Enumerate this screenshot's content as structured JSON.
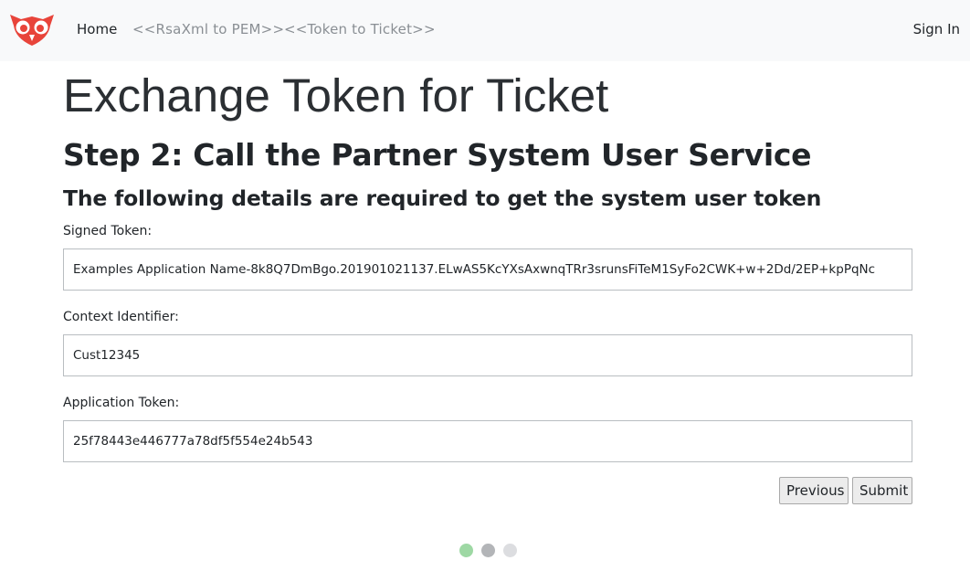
{
  "nav": {
    "home": "Home",
    "rsaxml": "<<RsaXml to PEM>>",
    "token_to_ticket": "<<Token to Ticket>>",
    "sign_in": "Sign In"
  },
  "page": {
    "title": "Exchange Token for Ticket",
    "step_heading": "Step 2: Call the Partner System User Service",
    "sub_heading": "The following details are required to get the system user token"
  },
  "form": {
    "signed_token": {
      "label": "Signed Token:",
      "value": "Examples Application Name-8k8Q7DmBgo.201901021137.ELwAS5KcYXsAxwnqTRr3srunsFiTeM1SyFo2CWK+w+2Dd/2EP+kpPqNc"
    },
    "context_identifier": {
      "label": "Context Identifier:",
      "value": "Cust12345"
    },
    "application_token": {
      "label": "Application Token:",
      "value": "25f78443e446777a78df5f554e24b543"
    }
  },
  "buttons": {
    "previous": "Previous",
    "submit": "Submit"
  },
  "progress": {
    "current_step": 1,
    "total_steps": 3,
    "colors": {
      "done": "#9ed8a4",
      "active": "#b3b5b8",
      "pending": "#dcdde0"
    }
  },
  "colors": {
    "navbar_bg": "#f8f9fa",
    "logo": "#e8443a"
  }
}
